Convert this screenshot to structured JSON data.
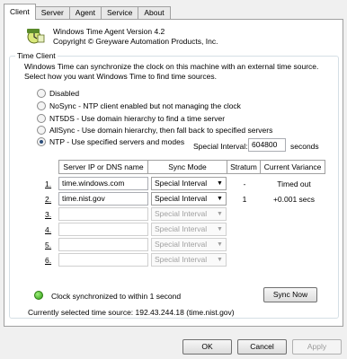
{
  "tabs": [
    "Client",
    "Server",
    "Agent",
    "Service",
    "About"
  ],
  "product": {
    "title": "Windows Time Agent Version 4.2",
    "copyright": "Copyright © Greyware Automation Products, Inc."
  },
  "group_title": "Time Client",
  "intro": "Windows Time can synchronize the clock on this machine with an external time source. Select how you want Windows Time to find time sources.",
  "modes": [
    {
      "label": "Disabled",
      "checked": false
    },
    {
      "label": "NoSync - NTP client enabled but not managing the clock",
      "checked": false
    },
    {
      "label": "NT5DS - Use domain hierarchy to find a time server",
      "checked": false
    },
    {
      "label": "AllSync - Use domain hierarchy, then fall back to specified servers",
      "checked": false
    },
    {
      "label": "NTP - Use specified servers and modes",
      "checked": true
    }
  ],
  "special_interval": {
    "label": "Special Interval:",
    "value": "604800",
    "unit": "seconds"
  },
  "table": {
    "headers": [
      "Server IP or DNS name",
      "Sync Mode",
      "Stratum",
      "Current Variance"
    ],
    "rows": [
      {
        "num": "1.",
        "server": "time.windows.com",
        "mode": "Special Interval",
        "stratum": "-",
        "variance": "Timed out",
        "enabled": true
      },
      {
        "num": "2.",
        "server": "time.nist.gov",
        "mode": "Special Interval",
        "stratum": "1",
        "variance": "+0.001 secs",
        "enabled": true
      },
      {
        "num": "3.",
        "server": "",
        "mode": "Special Interval",
        "stratum": "",
        "variance": "",
        "enabled": false
      },
      {
        "num": "4.",
        "server": "",
        "mode": "Special Interval",
        "stratum": "",
        "variance": "",
        "enabled": false
      },
      {
        "num": "5.",
        "server": "",
        "mode": "Special Interval",
        "stratum": "",
        "variance": "",
        "enabled": false
      },
      {
        "num": "6.",
        "server": "",
        "mode": "Special Interval",
        "stratum": "",
        "variance": "",
        "enabled": false
      }
    ]
  },
  "status": "Clock synchronized to within 1 second",
  "sync_now": "Sync Now",
  "current_source": "Currently selected time source:  192.43.244.18 (time.nist.gov)",
  "buttons": {
    "ok": "OK",
    "cancel": "Cancel",
    "apply": "Apply"
  },
  "colors": {
    "status_ok": "#2e9a14",
    "group_border": "#d5dfe5"
  }
}
